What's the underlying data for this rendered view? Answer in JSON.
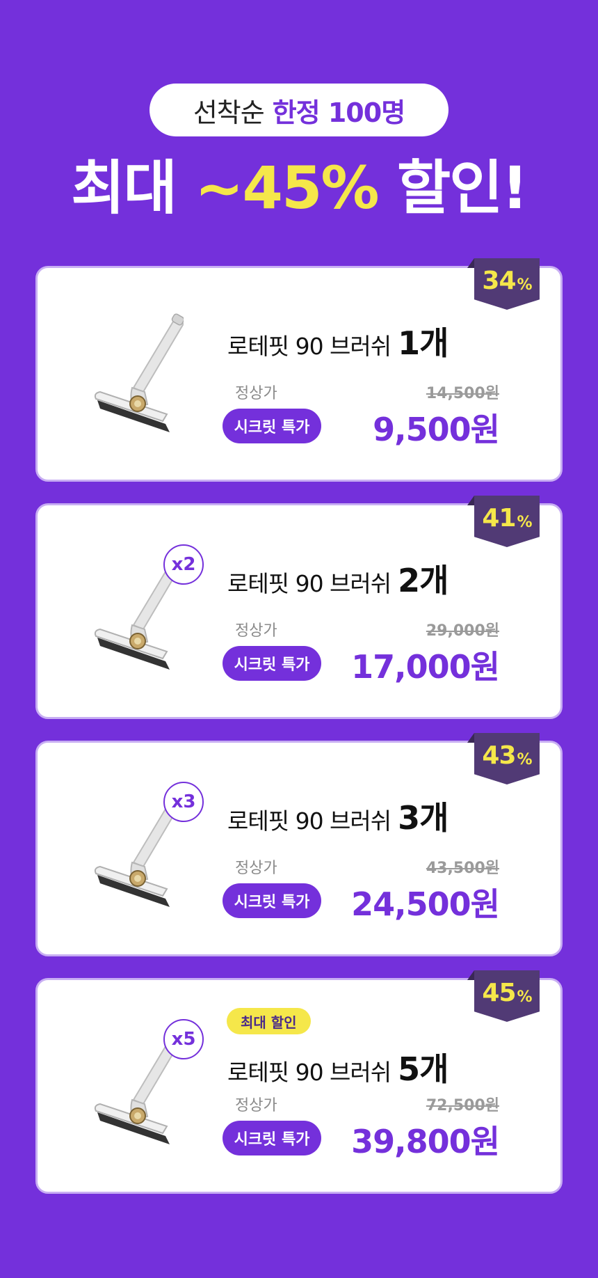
{
  "header": {
    "pill_plain": "선착순",
    "pill_highlight": "한정 100명",
    "headline_pre": "최대",
    "headline_discount": "~45%",
    "headline_post": "할인!"
  },
  "colors": {
    "background": "#7430DB",
    "accent_purple": "#7430DB",
    "accent_yellow": "#F5E74A",
    "ribbon": "#513A75"
  },
  "cards": [
    {
      "discount_num": "34",
      "discount_unit": "%",
      "quantity_badge": "",
      "max_badge": "",
      "title_text": "로테핏 90 브러쉬",
      "title_count": "1개",
      "regular_label": "정상가",
      "regular_price": "14,500원",
      "secret_label": "시크릿 특가",
      "sale_price": "9,500원"
    },
    {
      "discount_num": "41",
      "discount_unit": "%",
      "quantity_badge": "x2",
      "max_badge": "",
      "title_text": "로테핏 90 브러쉬",
      "title_count": "2개",
      "regular_label": "정상가",
      "regular_price": "29,000원",
      "secret_label": "시크릿 특가",
      "sale_price": "17,000원"
    },
    {
      "discount_num": "43",
      "discount_unit": "%",
      "quantity_badge": "x3",
      "max_badge": "",
      "title_text": "로테핏 90 브러쉬",
      "title_count": "3개",
      "regular_label": "정상가",
      "regular_price": "43,500원",
      "secret_label": "시크릿 특가",
      "sale_price": "24,500원"
    },
    {
      "discount_num": "45",
      "discount_unit": "%",
      "quantity_badge": "x5",
      "max_badge": "최대 할인",
      "title_text": "로테핏 90 브러쉬",
      "title_count": "5개",
      "regular_label": "정상가",
      "regular_price": "72,500원",
      "secret_label": "시크릿 특가",
      "sale_price": "39,800원"
    }
  ]
}
